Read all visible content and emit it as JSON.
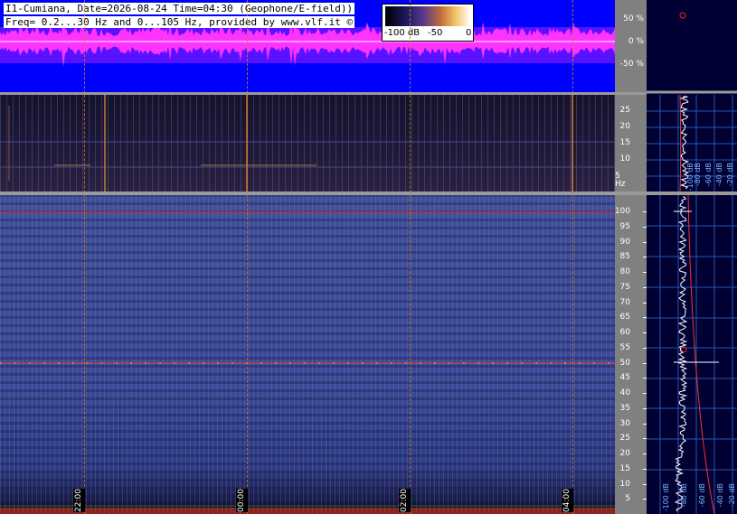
{
  "header": {
    "title_line1": "I1-Cumiana, Date=2026-08-24 Time=04:30 (Geophone/E-field))",
    "title_line2": "Freq= 0.2...30 Hz and 0...105 Hz, provided by www.vlf.it ©"
  },
  "colorbar": {
    "labels": [
      "-100 dB",
      "-50",
      "0"
    ]
  },
  "amplitude_axis": {
    "ticks": [
      "50 %",
      "0 %",
      "-50 %"
    ]
  },
  "lf_axis": {
    "ticks": [
      "25",
      "20",
      "15",
      "10",
      "5 Hz"
    ]
  },
  "hf_axis": {
    "ticks": [
      "100",
      "95",
      "90",
      "85",
      "80",
      "75",
      "70",
      "65",
      "60",
      "55",
      "50",
      "45",
      "40",
      "35",
      "30",
      "25",
      "20",
      "15",
      "10",
      "5"
    ]
  },
  "time_axis": {
    "labels": [
      "22:00",
      "00:00",
      "02:00",
      "04:00"
    ]
  },
  "lf_side_db": [
    "-100 dB",
    "-80 dB",
    "-60 dB",
    "-40 dB",
    "-20 dB"
  ],
  "hf_side_db": [
    "-100 dB",
    "-80 dB",
    "-60 dB",
    "-40 dB",
    "-20 dB"
  ],
  "colors": {
    "amplitude_trace": "#ff33ff",
    "background_blue": "#0000ff",
    "marker_line": "#ff3030",
    "event_line": "#d07a20"
  }
}
